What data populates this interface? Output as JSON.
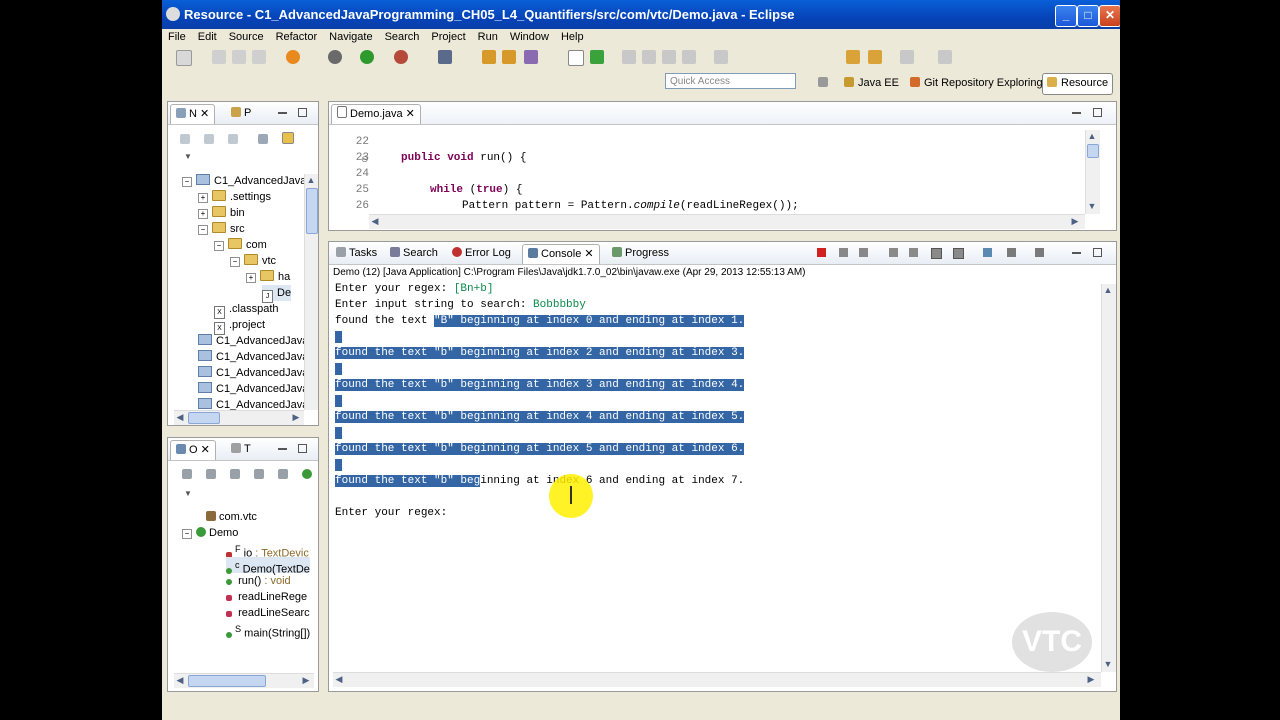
{
  "window": {
    "title": "Resource - C1_AdvancedJavaProgramming_CH05_L4_Quantifiers/src/com/vtc/Demo.java - Eclipse"
  },
  "menu": [
    "File",
    "Edit",
    "Source",
    "Refactor",
    "Navigate",
    "Search",
    "Project",
    "Run",
    "Window",
    "Help"
  ],
  "quick_access": {
    "placeholder": "Quick Access"
  },
  "perspectives": [
    "Java EE",
    "Git Repository Exploring",
    "Resource"
  ],
  "navigator": {
    "tabs": [
      "N",
      "P"
    ],
    "items": [
      {
        "label": "C1_AdvancedJava",
        "type": "project",
        "expanded": true
      },
      {
        "label": ".settings",
        "type": "folder"
      },
      {
        "label": "bin",
        "type": "folder"
      },
      {
        "label": "src",
        "type": "folder",
        "expanded": true
      },
      {
        "label": "com",
        "type": "folder",
        "expanded": true
      },
      {
        "label": "vtc",
        "type": "folder",
        "expanded": true
      },
      {
        "label": "ha",
        "type": "folder"
      },
      {
        "label": "De",
        "type": "java-file"
      },
      {
        "label": ".classpath",
        "type": "xml-file"
      },
      {
        "label": ".project",
        "type": "xml-file"
      },
      {
        "label": "C1_AdvancedJava",
        "type": "project"
      },
      {
        "label": "C1_AdvancedJava",
        "type": "project"
      },
      {
        "label": "C1_AdvancedJava",
        "type": "project"
      },
      {
        "label": "C1_AdvancedJava",
        "type": "project"
      },
      {
        "label": "C1_AdvancedJava",
        "type": "project"
      }
    ]
  },
  "outline": {
    "tabs": [
      "O",
      "T"
    ],
    "items": [
      {
        "label": "com.vtc",
        "type": "package"
      },
      {
        "label": "Demo",
        "type": "class"
      },
      {
        "label": "io",
        "suffix": " : TextDevic",
        "mod": "F"
      },
      {
        "label": "Demo(TextDe",
        "suffix": "",
        "mod": "c"
      },
      {
        "label": "run()",
        "suffix": " : void",
        "mod": ""
      },
      {
        "label": "readLineRege",
        "suffix": "",
        "mod": ""
      },
      {
        "label": "readLineSearc",
        "suffix": "",
        "mod": ""
      },
      {
        "label": "main(String[])",
        "suffix": "",
        "mod": "S"
      }
    ]
  },
  "editor": {
    "tab": "Demo.java",
    "lines": [
      {
        "n": "22",
        "text": ""
      },
      {
        "n": "23",
        "text": "public void run() {"
      },
      {
        "n": "24",
        "text": ""
      },
      {
        "n": "25",
        "text": "while (true) {"
      },
      {
        "n": "26",
        "text": "Pattern pattern = Pattern.compile(readLineRegex());"
      }
    ]
  },
  "console_view": {
    "tabs": [
      "Tasks",
      "Search",
      "Error Log",
      "Console",
      "Progress"
    ],
    "header": "Demo (12) [Java Application] C:\\Program Files\\Java\\jdk1.7.0_02\\bin\\javaw.exe (Apr 29, 2013 12:55:13 AM)",
    "prompt_regex": "Enter your regex:",
    "regex_value": "[Bn+b]",
    "prompt_input": "Enter input string to search:",
    "input_value": "Bobbbbby",
    "found_prefix": "found the text",
    "results": [
      "\"B\" beginning at index 0 and ending at index 1.",
      "found the text \"b\" beginning at index 2 and ending at index 3.",
      "found the text \"b\" beginning at index 3 and ending at index 4.",
      "found the text \"b\" beginning at index 4 and ending at index 5.",
      "found the text \"b\" beginning at index 5 and ending at index 6."
    ],
    "last_selected": "found the text \"b\" beg",
    "last_rest": "inning at index 6 and ending at index 7.",
    "final_prompt": "Enter your regex:"
  },
  "watermark": "VTC",
  "colors": {
    "selection": "#3465a4",
    "keyword": "#7f0055",
    "user_input": "#0a8a4a"
  }
}
